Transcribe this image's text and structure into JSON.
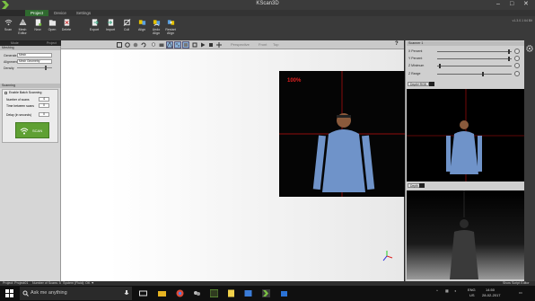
{
  "window": {
    "title": "KScan3D",
    "version": "v1.3.0.1 64 Bit",
    "controls": [
      "–",
      "□",
      "✕"
    ]
  },
  "ribbon": {
    "tabs": [
      "Project",
      "Device",
      "Settings"
    ],
    "active_tab": "Project",
    "buttons": [
      {
        "label": "Scan",
        "icon": "wifi-scan-icon"
      },
      {
        "label": "Mesh\nEditor",
        "icon": "mesh-editor-icon"
      },
      {
        "label": "New",
        "icon": "new-file-icon"
      },
      {
        "label": "Open",
        "icon": "open-folder-icon"
      },
      {
        "label": "Delete",
        "icon": "delete-icon"
      },
      {
        "label": "Export",
        "icon": "export-icon"
      },
      {
        "label": "Import",
        "icon": "import-icon"
      },
      {
        "label": "Cull",
        "icon": "cull-icon"
      },
      {
        "label": "Align",
        "icon": "align-icon"
      },
      {
        "label": "Undo\nAlign",
        "icon": "undo-align-icon"
      },
      {
        "label": "Restart\nAlign",
        "icon": "restart-align-icon"
      }
    ],
    "groups": [
      "Mode",
      "Project",
      "Scan",
      "Alignment",
      "Combine"
    ]
  },
  "left_panel": {
    "meshing": {
      "title": "Meshing",
      "generate_label": "Generate",
      "generate_value": "Mesh",
      "alignment_label": "Alignment",
      "alignment_value": "Mesh Geometry",
      "density_label": "Density",
      "density_level": 0.85
    },
    "scanning": {
      "title": "Scanning",
      "enable_label": "Enable Batch Scanning",
      "num_scans_label": "Number of scans",
      "num_scans_value": "4",
      "time_between_label": "Time between scans",
      "time_between_value": "0",
      "delay_label": "Delay (in seconds)",
      "delay_value": "0",
      "scan_button": "SCAN"
    }
  },
  "viewport": {
    "toolbar_text": [
      "Perspective",
      "Front",
      "Top"
    ],
    "progress_label": "100%"
  },
  "right_panel": {
    "title": "Scanner 1",
    "sliders": [
      {
        "label": "X Percent",
        "level": 0.97
      },
      {
        "label": "Y Percent",
        "level": 0.97
      },
      {
        "label": "Z Minimum",
        "level": 0.03
      },
      {
        "label": "Z Range",
        "level": 0.62
      }
    ],
    "top_tab": "Depth+RGB",
    "bottom_tab": "Depth"
  },
  "status": {
    "project": "Project: Project01",
    "scans": "Number of Scans: 5",
    "system": "System (Fluid): OK ▼",
    "script": "Show Script Editor"
  },
  "taskbar": {
    "search_placeholder": "Ask me anything",
    "lang": "ENG",
    "region": "US",
    "time": "14:50",
    "date": "28-02-2017"
  },
  "colors": {
    "ribbon_active": "#2f6a2f",
    "scan_button": "#5fa033",
    "progress_text": "#e02020",
    "grid_lines": "#c01010"
  }
}
